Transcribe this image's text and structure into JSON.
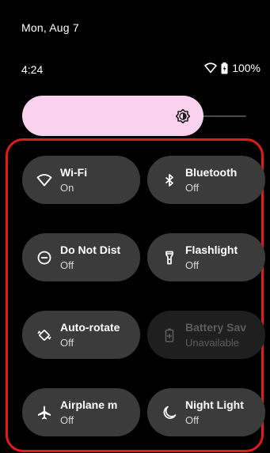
{
  "header": {
    "date": "Mon, Aug 7",
    "time": "4:24",
    "battery": "100%"
  },
  "brightness": {
    "level": 0.8
  },
  "tiles": [
    {
      "label": "Wi-Fi",
      "status": "On",
      "icon": "wifi-icon",
      "state": "active"
    },
    {
      "label": "Bluetooth",
      "status": "Off",
      "icon": "bluetooth-icon",
      "state": "off"
    },
    {
      "label": "Do Not Dist",
      "status": "Off",
      "icon": "do-not-disturb-icon",
      "state": "off"
    },
    {
      "label": "Flashlight",
      "status": "Off",
      "icon": "flashlight-icon",
      "state": "off"
    },
    {
      "label": "Auto-rotate",
      "status": "Off",
      "icon": "auto-rotate-icon",
      "state": "off"
    },
    {
      "label": "Battery Sav",
      "status": "Unavailable",
      "icon": "battery-saver-icon",
      "state": "disabled"
    },
    {
      "label": "Airplane m",
      "status": "Off",
      "icon": "airplane-icon",
      "state": "off"
    },
    {
      "label": "Night Light",
      "status": "Off",
      "icon": "night-light-icon",
      "state": "off"
    }
  ],
  "colors": {
    "active_tile": "#fbd2ee",
    "tile": "#3b3b3b",
    "highlight": "#e01b1b"
  }
}
